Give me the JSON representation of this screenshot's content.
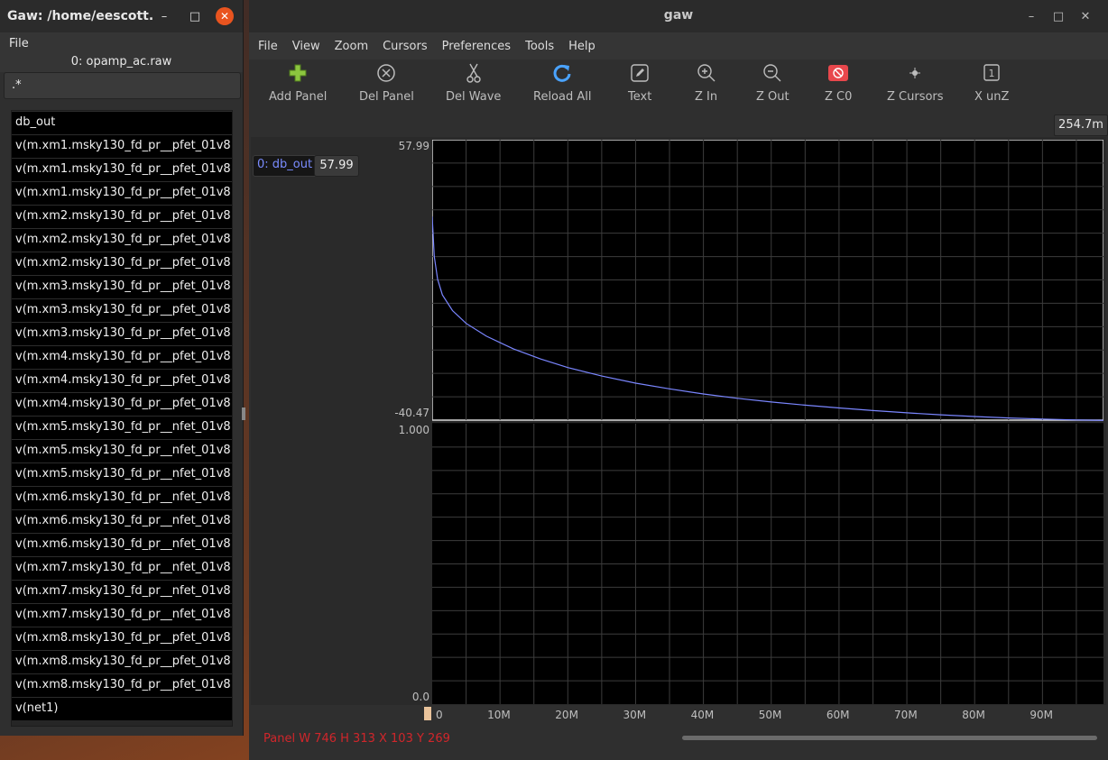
{
  "left_window": {
    "title": "Gaw: /home/eescott...",
    "menu": [
      "File"
    ],
    "file_label": "0: opamp_ac.raw",
    "filter_value": ".*",
    "waves": [
      "db_out",
      "v(m.xm1.msky130_fd_pr__pfet_01v8",
      "v(m.xm1.msky130_fd_pr__pfet_01v8",
      "v(m.xm1.msky130_fd_pr__pfet_01v8",
      "v(m.xm2.msky130_fd_pr__pfet_01v8",
      "v(m.xm2.msky130_fd_pr__pfet_01v8",
      "v(m.xm2.msky130_fd_pr__pfet_01v8",
      "v(m.xm3.msky130_fd_pr__pfet_01v8",
      "v(m.xm3.msky130_fd_pr__pfet_01v8",
      "v(m.xm3.msky130_fd_pr__pfet_01v8",
      "v(m.xm4.msky130_fd_pr__pfet_01v8",
      "v(m.xm4.msky130_fd_pr__pfet_01v8",
      "v(m.xm4.msky130_fd_pr__pfet_01v8",
      "v(m.xm5.msky130_fd_pr__nfet_01v8",
      "v(m.xm5.msky130_fd_pr__nfet_01v8",
      "v(m.xm5.msky130_fd_pr__nfet_01v8",
      "v(m.xm6.msky130_fd_pr__nfet_01v8",
      "v(m.xm6.msky130_fd_pr__nfet_01v8",
      "v(m.xm6.msky130_fd_pr__nfet_01v8",
      "v(m.xm7.msky130_fd_pr__nfet_01v8",
      "v(m.xm7.msky130_fd_pr__nfet_01v8",
      "v(m.xm7.msky130_fd_pr__nfet_01v8",
      "v(m.xm8.msky130_fd_pr__pfet_01v8",
      "v(m.xm8.msky130_fd_pr__pfet_01v8",
      "v(m.xm8.msky130_fd_pr__pfet_01v8",
      "v(net1)"
    ]
  },
  "right_window": {
    "title": "gaw",
    "menu": [
      "File",
      "View",
      "Zoom",
      "Cursors",
      "Preferences",
      "Tools",
      "Help"
    ],
    "toolbar": [
      {
        "label": "Add Panel",
        "icon": "plus-icon"
      },
      {
        "label": "Del Panel",
        "icon": "circle-x-icon"
      },
      {
        "label": "Del Wave",
        "icon": "scissors-icon"
      },
      {
        "label": "Reload All",
        "icon": "reload-icon"
      },
      {
        "label": "Text",
        "icon": "pencil-icon"
      },
      {
        "label": "Z In",
        "icon": "zoom-in-icon"
      },
      {
        "label": "Z Out",
        "icon": "zoom-out-icon"
      },
      {
        "label": "Z C0",
        "icon": "zoom-c0-icon"
      },
      {
        "label": "Z Cursors",
        "icon": "zoom-cursors-icon"
      },
      {
        "label": "X unZ",
        "icon": "x-unzoom-icon"
      }
    ],
    "cursor_readout": "254.7m",
    "wave_button": "0: db_out",
    "wave_value": "57.99",
    "status": "Panel W 746 H 313 X 103 Y 269",
    "colors": {
      "wave": "#7a86ff",
      "status": "#d1262b",
      "close": "#e9541f"
    }
  },
  "chart_data": [
    {
      "type": "line",
      "panel": "top",
      "series": [
        {
          "name": "db_out",
          "x": [
            0,
            0.3,
            0.8,
            1.5,
            3,
            5,
            8,
            12,
            16,
            20,
            25,
            30,
            35,
            40,
            45,
            50,
            55,
            60,
            65,
            70,
            75,
            80,
            85,
            90,
            95,
            100
          ],
          "y": [
            31,
            17,
            9,
            3.5,
            -2,
            -6.5,
            -11,
            -15.5,
            -19,
            -22,
            -25,
            -27.5,
            -29.5,
            -31.3,
            -32.8,
            -34.1,
            -35.2,
            -36.2,
            -37.1,
            -37.9,
            -38.6,
            -39.2,
            -39.7,
            -40.1,
            -40.4,
            -40.6
          ]
        }
      ],
      "y_ticks": [
        "57.99",
        "-40.47"
      ],
      "ylim": [
        -40.47,
        57.99
      ],
      "x_ticks": [
        "0",
        "10M",
        "20M",
        "30M",
        "40M",
        "50M",
        "60M",
        "70M",
        "80M",
        "90M"
      ],
      "xlim": [
        0,
        99
      ],
      "grid": true
    },
    {
      "type": "line",
      "panel": "bottom",
      "series": [],
      "y_ticks": [
        "1.000",
        "0.0"
      ],
      "ylim": [
        0,
        1
      ],
      "grid": true
    }
  ]
}
